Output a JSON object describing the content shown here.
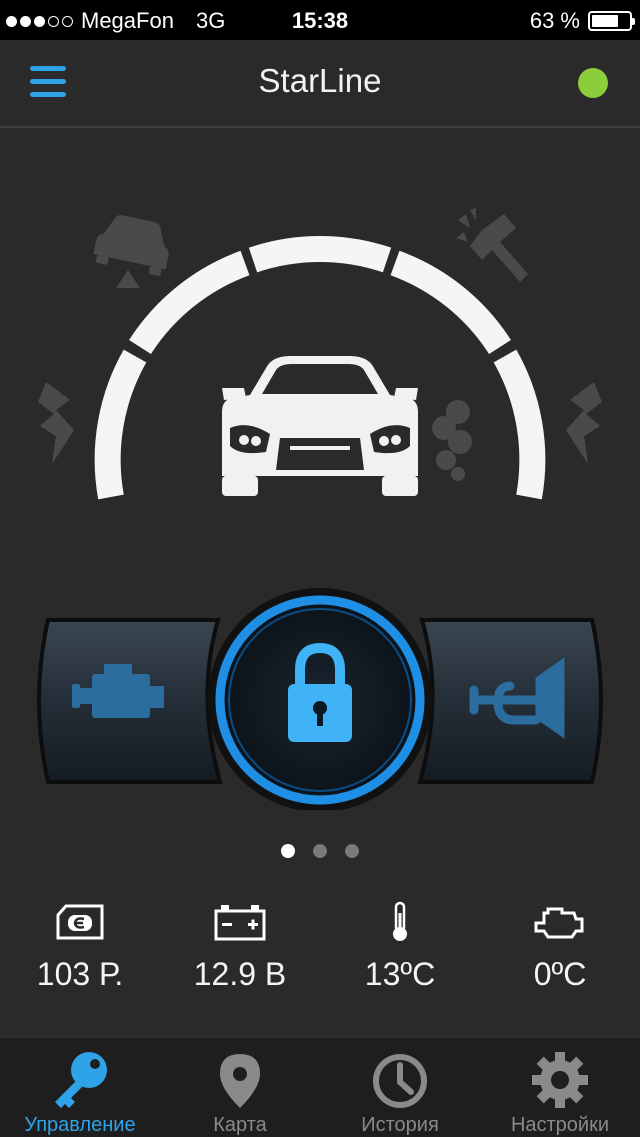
{
  "status_bar": {
    "carrier": "MegaFon",
    "network": "3G",
    "time": "15:38",
    "battery_text": "63 %",
    "signal_bars_filled": 3,
    "signal_bars_total": 5,
    "battery_level": 0.63
  },
  "header": {
    "title": "StarLine",
    "online_color": "#8bcd3a",
    "accent_color": "#2ea3e8"
  },
  "controls": {
    "left_button_icon": "engine-icon",
    "center_button_icon": "padlock-icon",
    "right_button_icon": "horn-icon",
    "lock_state": "locked"
  },
  "status_icons": [
    "car-tilt-icon",
    "hammer-impact-icon",
    "shock-left-icon",
    "shock-right-icon",
    "exhaust-smoke-icon"
  ],
  "pager": {
    "pages": 3,
    "active": 0
  },
  "stats": [
    {
      "icon": "balance-card-icon",
      "value": "103 Р."
    },
    {
      "icon": "battery-icon",
      "value": "12.9 В"
    },
    {
      "icon": "thermometer-icon",
      "value": "13ºC"
    },
    {
      "icon": "engine-temp-icon",
      "value": "0ºC"
    }
  ],
  "tabs": [
    {
      "label": "Управление",
      "icon": "key-icon",
      "active": true
    },
    {
      "label": "Карта",
      "icon": "map-pin-icon",
      "active": false
    },
    {
      "label": "История",
      "icon": "clock-icon",
      "active": false
    },
    {
      "label": "Настройки",
      "icon": "gear-icon",
      "active": false
    }
  ]
}
